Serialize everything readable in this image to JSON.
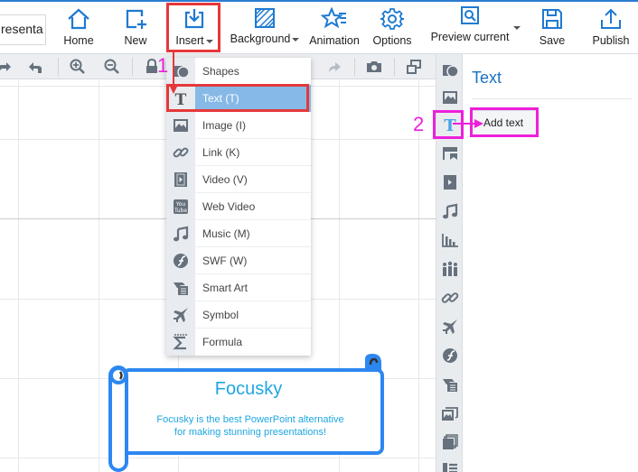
{
  "ribbon": {
    "title_field": "resenta",
    "buttons": [
      {
        "label": "Home",
        "icon": "home-icon"
      },
      {
        "label": "New",
        "icon": "new-icon"
      },
      {
        "label": "Insert",
        "icon": "insert-icon",
        "has_caret": true
      },
      {
        "label": "Background",
        "icon": "background-icon",
        "has_caret": true
      },
      {
        "label": "Animation",
        "icon": "animation-icon"
      },
      {
        "label": "Options",
        "icon": "gear-icon"
      },
      {
        "label": "Preview current",
        "icon": "preview-icon",
        "has_caret": true
      },
      {
        "label": "Save",
        "icon": "save-icon"
      },
      {
        "label": "Publish",
        "icon": "publish-icon"
      }
    ]
  },
  "toolbar": {
    "icons": [
      "redo-icon",
      "undo-icon",
      "zoom-in-icon",
      "zoom-out-icon",
      "lock-icon",
      "redo-arrow-icon",
      "camera-icon",
      "duplicate-icon"
    ]
  },
  "insert_menu": {
    "items": [
      {
        "label": "Shapes",
        "icon": "shapes-icon"
      },
      {
        "label": "Text (T)",
        "icon": "text-icon",
        "selected": true
      },
      {
        "label": "Image (I)",
        "icon": "image-icon"
      },
      {
        "label": "Link (K)",
        "icon": "link-icon"
      },
      {
        "label": "Video (V)",
        "icon": "video-icon"
      },
      {
        "label": "Web Video",
        "icon": "youtube-icon"
      },
      {
        "label": "Music (M)",
        "icon": "music-icon"
      },
      {
        "label": "SWF (W)",
        "icon": "swf-icon"
      },
      {
        "label": "Smart Art",
        "icon": "smart-art-icon"
      },
      {
        "label": "Symbol",
        "icon": "airplane-icon"
      },
      {
        "label": "Formula",
        "icon": "sigma-icon"
      }
    ]
  },
  "canvas": {
    "banner_title": "Focusky",
    "banner_line1": "Focusky is the best PowerPoint alternative",
    "banner_line2": "for making stunning presentations!"
  },
  "right_strip": {
    "icons": [
      "shapes-icon",
      "image-icon",
      "text-icon",
      "background-icon",
      "video-icon",
      "music-icon",
      "chart-icon",
      "people-icon",
      "link-icon",
      "airplane-icon",
      "swf-icon",
      "smart-art-icon",
      "gallery-icon",
      "layers-icon",
      "list-icon"
    ]
  },
  "panel": {
    "title": "Text",
    "add_text_label": "Add text"
  },
  "annotations": {
    "step1": "1",
    "step2": "2"
  },
  "colors": {
    "accent": "#1a72c2",
    "icon_blue": "#1e7ad2",
    "menu_selected": "#86b9e6",
    "annotation_red": "#e5383b",
    "annotation_magenta": "#ee1fdb",
    "banner_text": "#1ea7e1",
    "banner_stroke": "#2d87f0"
  }
}
